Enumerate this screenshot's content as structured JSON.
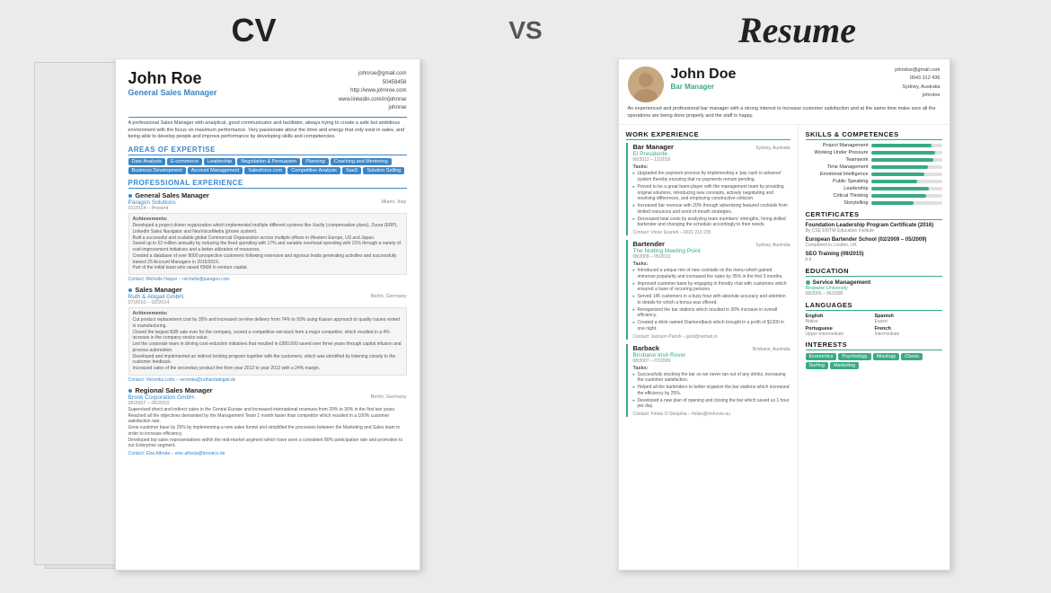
{
  "page": {
    "background": "#ebebeb",
    "cv_label": "CV",
    "vs_label": "VS",
    "resume_label": "Resume"
  },
  "cv": {
    "name": "John Roe",
    "title": "General Sales Manager",
    "contact": {
      "email": "johnroe@gmail.com",
      "phone": "50458456",
      "website": "http://www.johnroe.com",
      "linkedin": "www.linkedin.com/in/johnroe",
      "skype": "johnroe"
    },
    "bio": "A professional Sales Manager with analytical, good communicator and facilitator, always trying to create a safe but ambitious environment with the focus on maximum performance. Very passionate about the drive and energy that only exist in sales, and being able to develop people and improve performance by developing skills and competencies.",
    "areas_of_expertise_title": "AREAS OF EXPERTISE",
    "skills": [
      "Date Analysis",
      "E-commerce",
      "Leadership",
      "Negotiation & Persuasion",
      "Planning",
      "Coaching and Mentoring",
      "Business Development",
      "Account Management",
      "Salesforce.com",
      "Competitive Analysis",
      "SaaS",
      "Solution Selling"
    ],
    "professional_experience_title": "PROFESSIONAL EXPERIENCE",
    "jobs": [
      {
        "title": "General Sales Manager",
        "company": "Paragon Solutions",
        "date": "01/2014 – Present",
        "location": "Miami, Italy",
        "achievements_title": "Achievements:",
        "bullets": [
          "Developed a project driven organization which implemented multiple different systems like Xactly (compensation plans), Zuora (ERP), LinkedIn Sales Navigator and NeuVoiceMedia (phone system).",
          "Built a successful and scalable global Commercial Organization across multiple offices in Western Europe, US and Japan.",
          "Saved up to €2 million annually by reducing the fixed spending with 17% and variable overhead spending with 21% through a variety of cost-improvement initiatives and a better utilization of resources.",
          "Created a database of over 8000 prospective customers following extensive and rigorous leads generating activities and successfully trained 25 Account Managers in 2015/2016.",
          "Part of the initial team who raised €56M in venture capital."
        ],
        "contact": "Contact: Michelle Harper – michelle@paragon.com"
      },
      {
        "title": "Sales Manager",
        "company": "Ruth & Abigail GmbH.",
        "date": "07/2010 – 02/2014",
        "location": "Berlin, Germany",
        "achievements_title": "Achievements:",
        "bullets": [
          "Cut product replacement cost by 35% and increased on-time delivery from 74% to 93% using Kaizen approach to quality issues rooted in manufacturing.",
          "Closed the largest B2B sale ever for the company, scored a competitive win-back from a major competitor, which resulted in a 4% increase in the company stocks value.",
          "Led the corporate team in driving cost-reduction initiatives that resulted in £800.000 saved over three years through capital infusion and process automation.",
          "Developed and implemented an indirect lending program together with the customers, which was identified by listening closely to the customer feedback.",
          "Increased sales of the secondary product line from year 2012 to year 2013 with a 24% margin."
        ],
        "contact": "Contact: Veronika Lotte – veronika@ruthandabigail.de"
      },
      {
        "title": "Regional Sales Manager",
        "company": "Brook Corporation GmbH.",
        "date": "05/2007 – 06/2010",
        "location": "Berlin, Germany",
        "achievements_title": "Achievements:",
        "bullets": [
          "Supervised direct and indirect sales in the Central Europe and increased international revenues from 20% to 30% in the first two years.",
          "Reached all the objectives demanded by the Management Team 1 month faster than competitor which resulted in a 100% customer satisfaction rate.",
          "Grew customer base by 25% by implementing a new sales funnel and simplified the processes between the Marketing and Sales team in order to increase efficiency.",
          "Developed top sales representatives within the mid-market segment which have seen a consistent 80% participation rate and promotion to our Enterprise segment."
        ],
        "contact": "Contact: Else Alfreda – else.alfreda@brookco.de"
      }
    ]
  },
  "resume": {
    "name": "John Doe",
    "role": "Bar Manager",
    "contact": {
      "email": "johndoe@gmail.com",
      "phone": "0043 312 436",
      "location": "Sydney, Australia",
      "skype": "johndoe"
    },
    "bio": "An experienced and professional bar manager with a strong interest to increase customer satisfaction and at the same time make sure all the operations are being done properly and the staff is happy.",
    "work_experience_title": "WORK EXPERIENCE",
    "jobs": [
      {
        "title": "Bar Manager",
        "company": "El Presidente",
        "date": "06/2013 – 12/2019",
        "location": "Sydney, Australia",
        "tasks_label": "Tasks:",
        "bullets": [
          "Upgraded the payment process by implementing a 'pay cash in advance' system thereby ensuring that no payments remain pending.",
          "Proved to be a great team-player with the management team by providing original solutions, introducing new concepts, actively negotiating and resolving differences, and employing constructive criticism.",
          "Increased bar revenue with 20% through advertising featured cocktails from limited resources and word-of-mouth strategies.",
          "Decreased total costs by analyzing team members' strengths, hiring skilled bartender and changing the schedule accordingly to their needs."
        ],
        "contact": "Contact: Vince Scarlett – 0021 213 235"
      },
      {
        "title": "Bartender",
        "company": "The Notting Meeting Point",
        "date": "08/2009 – 05/2013",
        "location": "Sydney, Australia",
        "tasks_label": "Tasks:",
        "bullets": [
          "Introduced a unique mix of new cocktails on the menu which gained immense popularity and increased the sales by 35% in the first 3 months.",
          "Improved customer base by engaging in friendly chat with customers which ensured a base of recurring persons.",
          "Served 145 customers in a busy hour with absolute accuracy and attention to details for which a bonus was offered.",
          "Reorganized the bar stations which resulted in 30% increase in overall efficiency.",
          "Created a drink named Diamondback which brought in a profit of $1300 in one night."
        ],
        "contact": "Contact: Jackson Parish – jack@nomad.in"
      },
      {
        "title": "Barback",
        "company": "Brisbane Irish Rover",
        "date": "08/2007 – 07/2009",
        "location": "Brisbane, Australia",
        "tasks_label": "Tasks:",
        "bullets": [
          "Successfully stocking the bar so we never ran out of any drinks, increasing the customer satisfaction.",
          "Helped all the bartenders to better organize the bar stations which increased the efficiency by 25%.",
          "Developed a new plan of opening and closing the bar which saved us 1 hour per day."
        ],
        "contact": "Contact: Fintan O Sleáphia – fintan@irishover.au"
      }
    ],
    "skills_title": "SKILLS & COMPETENCES",
    "skills": [
      {
        "name": "Project Management",
        "pct": 85
      },
      {
        "name": "Working Under Pressure",
        "pct": 90
      },
      {
        "name": "Teamwork",
        "pct": 88
      },
      {
        "name": "Time Management",
        "pct": 80
      },
      {
        "name": "Emotional Intelligence",
        "pct": 75
      },
      {
        "name": "Public Speaking",
        "pct": 65
      },
      {
        "name": "Leadership",
        "pct": 82
      },
      {
        "name": "Critical Thinking",
        "pct": 78
      },
      {
        "name": "Storytelling",
        "pct": 60
      }
    ],
    "certificates_title": "CERTIFICATES",
    "certificates": [
      {
        "title": "Foundation Leadership Program Certificate (2016)",
        "issuer": "By CSE EMTW Education Institute"
      },
      {
        "title": "European Bartender School (02/2009 – 05/2009)",
        "issuer": "Completed in London, UK"
      },
      {
        "title": "SEO Training (09/2015)",
        "issuer": "b.b"
      }
    ],
    "education_title": "EDUCATION",
    "education": [
      {
        "degree": "Service Management",
        "school": "Brisbane University",
        "date": "08/2005 – 06/2008"
      }
    ],
    "languages_title": "LANGUAGES",
    "languages": [
      {
        "name": "English",
        "level": "Native"
      },
      {
        "name": "Spanish",
        "level": "Expert"
      },
      {
        "name": "Portuguese",
        "level": "Upper-intermediate"
      },
      {
        "name": "French",
        "level": "Intermediate"
      }
    ],
    "interests_title": "INTERESTS",
    "interests": [
      "Economics",
      "Psychology",
      "Mixology",
      "Chess",
      "Surfing",
      "Marketing"
    ]
  }
}
